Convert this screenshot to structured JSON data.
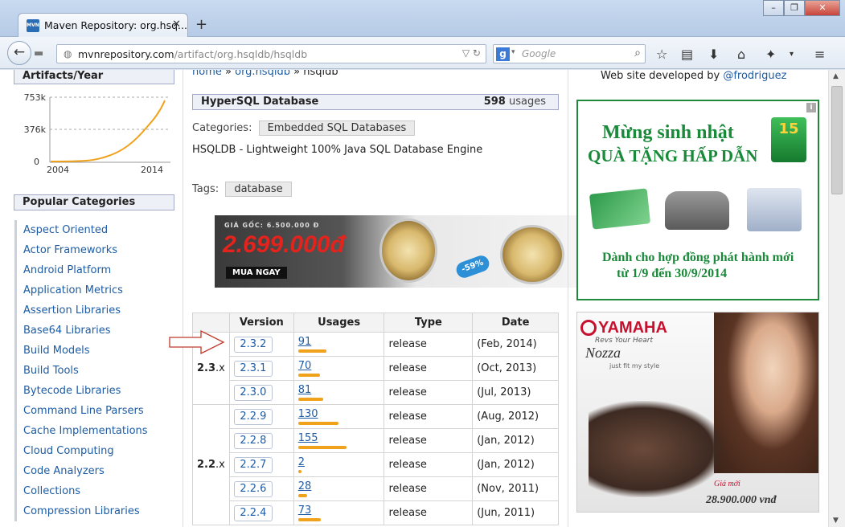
{
  "browser": {
    "tab_title": "Maven Repository: org.hsq...",
    "favicon_text": "MVN",
    "url_domain": "mvnrepository.com",
    "url_path": "/artifact/org.hsqldb/hsqldb",
    "search_placeholder": "Google",
    "search_engine_letter": "g"
  },
  "sidebar": {
    "trend_title": "Artifacts/Year",
    "trend_chart": {
      "y_ticks": [
        "753k",
        "376k",
        "0"
      ],
      "x_ticks": [
        "2004",
        "2014"
      ],
      "line_color": "#f0a21c"
    },
    "categories_title": "Popular Categories",
    "categories": [
      "Aspect Oriented",
      "Actor Frameworks",
      "Android Platform",
      "Application Metrics",
      "Assertion Libraries",
      "Base64 Libraries",
      "Build Models",
      "Build Tools",
      "Bytecode Libraries",
      "Command Line Parsers",
      "Cache Implementations",
      "Cloud Computing",
      "Code Analyzers",
      "Collections",
      "Compression Libraries"
    ]
  },
  "main": {
    "crumbs": {
      "home": "home",
      "group": "org.hsqldb",
      "sep": "»",
      "artifact": "hsqldb"
    },
    "title": "HyperSQL Database",
    "usages_count": "598",
    "usages_word": "usages",
    "categories_label": "Categories:",
    "category_tag": "Embedded SQL Databases",
    "description": "HSQLDB - Lightweight 100% Java SQL Database Engine",
    "tags_label": "Tags:",
    "tag": "database",
    "watch_ad": {
      "old_price": "GIÁ GỐC: 6.500.000 Đ",
      "new_price": "2.699.000đ",
      "buy_label": "MUA NGAY",
      "discount": "-59%"
    },
    "table": {
      "headers": [
        "Version",
        "Usages",
        "Type",
        "Date"
      ],
      "groups": [
        {
          "label": "2.3",
          "suffix": ".x",
          "rows": [
            {
              "version": "2.3.2",
              "usages": 91,
              "type": "release",
              "date": "(Feb, 2014)"
            },
            {
              "version": "2.3.1",
              "usages": 70,
              "type": "release",
              "date": "(Oct, 2013)"
            },
            {
              "version": "2.3.0",
              "usages": 81,
              "type": "release",
              "date": "(Jul, 2013)"
            }
          ]
        },
        {
          "label": "2.2",
          "suffix": ".x",
          "rows": [
            {
              "version": "2.2.9",
              "usages": 130,
              "type": "release",
              "date": "(Aug, 2012)"
            },
            {
              "version": "2.2.8",
              "usages": 155,
              "type": "release",
              "date": "(Jan, 2012)"
            },
            {
              "version": "2.2.7",
              "usages": 2,
              "type": "release",
              "date": "(Jan, 2012)"
            },
            {
              "version": "2.2.6",
              "usages": 28,
              "type": "release",
              "date": "(Nov, 2011)"
            },
            {
              "version": "2.2.4",
              "usages": 73,
              "type": "release",
              "date": "(Jun, 2011)"
            }
          ]
        }
      ],
      "usage_bar_color": "#f0a21c"
    }
  },
  "right": {
    "dev_text": "Web site developed by",
    "dev_link": "@frodriguez",
    "ad1": {
      "line1": "Mừng sinh nhật",
      "line2": "QUÀ TẶNG HẤP DẪN",
      "badge": "15",
      "line3": "Dành cho hợp đồng phát hành mới",
      "line4": "từ 1/9 đến 30/9/2014",
      "info": "i",
      "color": "#1a8a3a"
    },
    "ad2": {
      "brand": "YAMAHA",
      "tagline": "Revs Your Heart",
      "model": "Nozza",
      "sub": "just fit my style",
      "price_label": "Giá mới",
      "price": "28.900.000 vnđ",
      "info": "i"
    }
  }
}
